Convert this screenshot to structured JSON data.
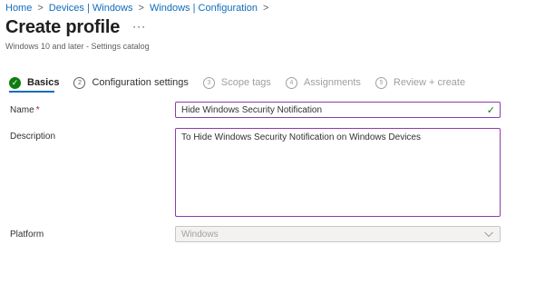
{
  "breadcrumb": {
    "items": [
      "Home",
      "Devices | Windows",
      "Windows | Configuration"
    ],
    "separator": ">"
  },
  "header": {
    "title": "Create profile",
    "more": "···",
    "subtitle": "Windows 10 and later - Settings catalog"
  },
  "steps": [
    {
      "index": "✓",
      "label": "Basics",
      "state": "completed-active"
    },
    {
      "index": "2",
      "label": "Configuration settings",
      "state": "current"
    },
    {
      "index": "3",
      "label": "Scope tags",
      "state": "disabled"
    },
    {
      "index": "4",
      "label": "Assignments",
      "state": "disabled"
    },
    {
      "index": "5",
      "label": "Review + create",
      "state": "disabled"
    }
  ],
  "form": {
    "name": {
      "label": "Name",
      "required_mark": "*",
      "value": "Hide Windows Security Notification",
      "valid_icon": "✓"
    },
    "description": {
      "label": "Description",
      "value": "To Hide Windows Security Notification on Windows Devices"
    },
    "platform": {
      "label": "Platform",
      "value": "Windows"
    }
  },
  "colors": {
    "link": "#0f6cbd",
    "field_border_focus": "#8a3dab",
    "success": "#107c10",
    "required": "#a4262c",
    "disabled_text": "#a19f9d"
  }
}
